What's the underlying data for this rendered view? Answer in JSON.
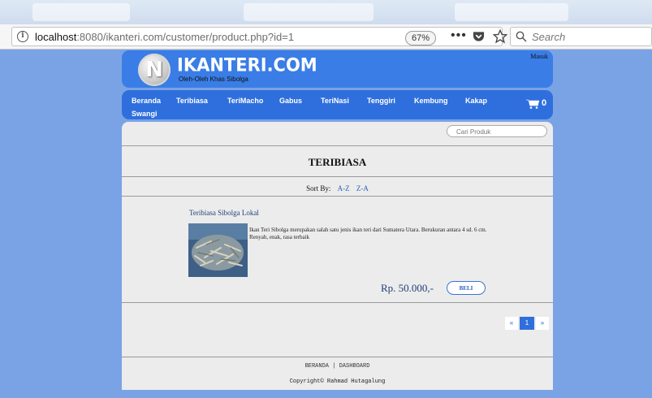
{
  "browser": {
    "url_host": "localhost",
    "url_rest": ":8080/ikanteri.com/customer/product.php?id=1",
    "zoom": "67%",
    "search_placeholder": "Search"
  },
  "site": {
    "logo_letter": "N",
    "title": "IKANTERI.COM",
    "tagline": "Oleh-Oleh Khas Sibolga",
    "login": "Masuk"
  },
  "menu": {
    "items": [
      "Beranda",
      "Teribiasa",
      "TeriMacho",
      "Gabus",
      "TeriNasi",
      "Tenggiri",
      "Kembung",
      "Kakap",
      "Swangi"
    ],
    "cart_count": "0"
  },
  "content": {
    "search_placeholder": "Cari Produk",
    "category_title": "TERIBIASA",
    "sort_label": "Sort By:",
    "sort_az": "A-Z",
    "sort_za": "Z-A",
    "product": {
      "name": "Teribiasa Sibolga Lokal",
      "description": "Ikan Teri Sibolga merupakan salah satu jenis ikan teri dari Sumatera Utara. Berukuran antara 4 sd. 6 cm. Renyah, enak, rasa terbaik",
      "price": "Rp. 50.000,-",
      "buy_label": "BELI"
    },
    "pagination": {
      "prev": "«",
      "current": "1",
      "next": "»"
    }
  },
  "footer": {
    "home": "BERANDA",
    "separator": "|",
    "dashboard": "DASHBOARD",
    "copyright": "Copyright© Rahmad Hutagalung"
  },
  "colors": {
    "page_background": "#7aa3e5",
    "header_blue": "#3a7de6",
    "menu_blue": "#2f6fdd",
    "content_bg": "#ececec"
  }
}
